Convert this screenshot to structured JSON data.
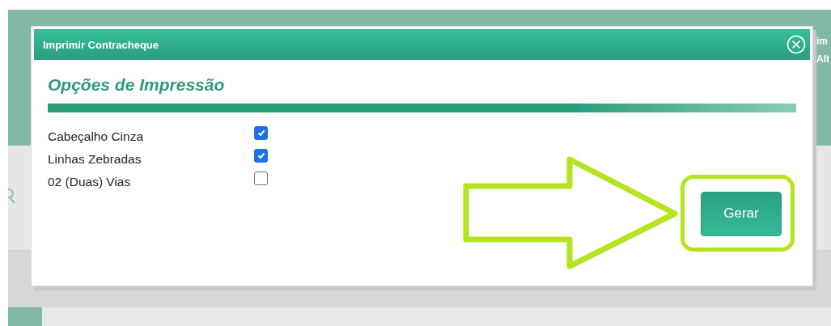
{
  "background": {
    "header_texts": [
      "im",
      "Alt"
    ]
  },
  "dialog": {
    "title": "Imprimir Contracheque",
    "section_title": "Opções de Impressão",
    "options": [
      {
        "label": "Cabeçalho Cinza",
        "checked": true
      },
      {
        "label": "Linhas Zebradas",
        "checked": true
      },
      {
        "label": "02 (Duas) Vias",
        "checked": false
      }
    ],
    "button": "Gerar"
  }
}
